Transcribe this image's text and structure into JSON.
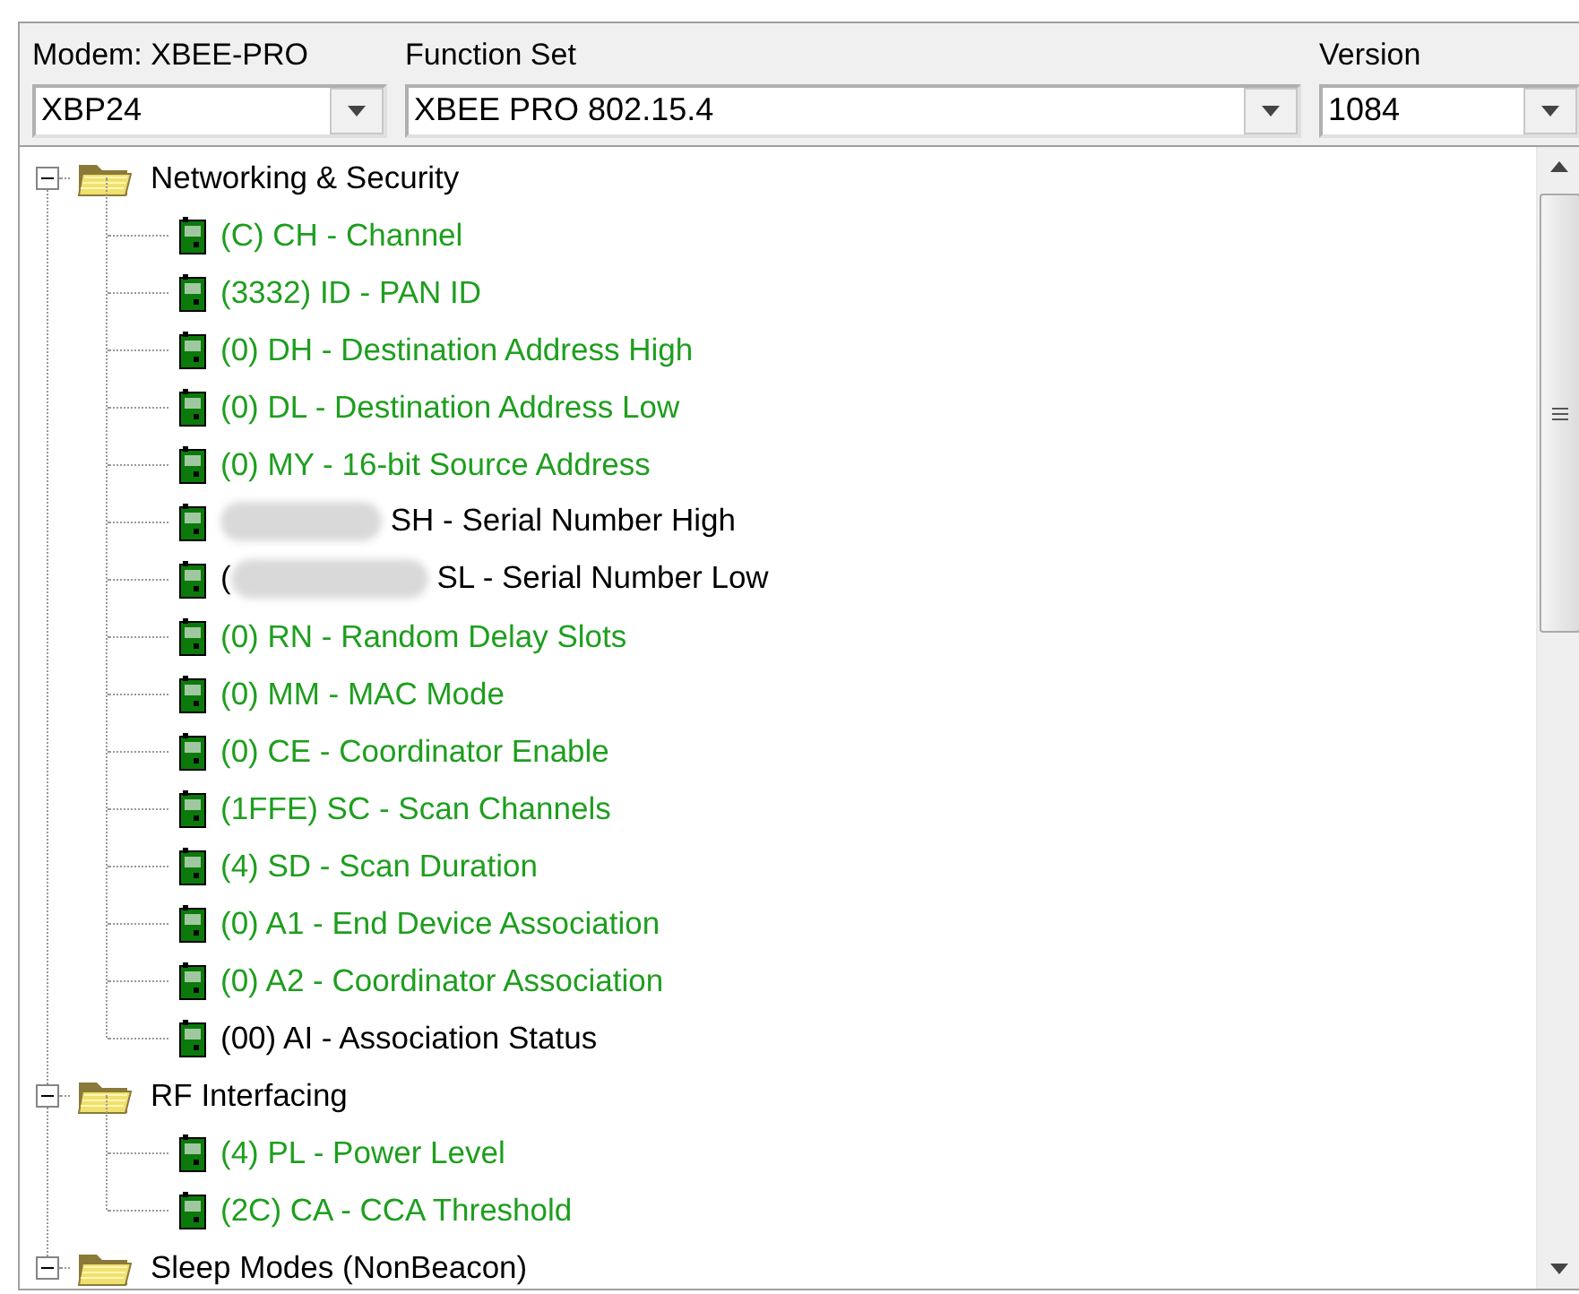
{
  "header": {
    "modem_label": "Modem: XBEE-PRO",
    "function_set_label": "Function Set",
    "version_label": "Version",
    "modem": {
      "value": "XBP24"
    },
    "function_set": {
      "value": "XBEE PRO 802.15.4"
    },
    "version": {
      "value": "1084"
    }
  },
  "tree": [
    {
      "label": "Networking & Security",
      "expanded": true,
      "children": [
        {
          "label": "(C) CH - Channel",
          "color": "#1e9e1e"
        },
        {
          "label": "(3332) ID - PAN ID",
          "color": "#1e9e1e"
        },
        {
          "label": "(0) DH - Destination Address High",
          "color": "#1e9e1e"
        },
        {
          "label": "(0) DL - Destination Address Low",
          "color": "#1e9e1e"
        },
        {
          "label": "(0) MY - 16-bit Source Address",
          "color": "#1e9e1e"
        },
        {
          "label": "SH - Serial Number High",
          "color": "#000000",
          "redacted": true
        },
        {
          "prefix": "(",
          "label": "SL - Serial Number Low",
          "color": "#000000",
          "redacted": true
        },
        {
          "label": "(0) RN - Random Delay Slots",
          "color": "#1e9e1e"
        },
        {
          "label": "(0) MM - MAC Mode",
          "color": "#1e9e1e"
        },
        {
          "label": "(0) CE - Coordinator Enable",
          "color": "#1e9e1e"
        },
        {
          "label": "(1FFE) SC - Scan Channels",
          "color": "#1e9e1e"
        },
        {
          "label": "(4) SD - Scan Duration",
          "color": "#1e9e1e"
        },
        {
          "label": "(0) A1 - End Device Association",
          "color": "#1e9e1e"
        },
        {
          "label": "(0) A2 - Coordinator Association",
          "color": "#1e9e1e"
        },
        {
          "label": "(00) AI - Association Status",
          "color": "#000000"
        }
      ]
    },
    {
      "label": "RF Interfacing",
      "expanded": true,
      "children": [
        {
          "label": "(4) PL - Power Level",
          "color": "#1e9e1e"
        },
        {
          "label": "(2C) CA - CCA Threshold",
          "color": "#1e9e1e"
        }
      ]
    },
    {
      "label": "Sleep Modes (NonBeacon)",
      "expanded": true
    }
  ]
}
